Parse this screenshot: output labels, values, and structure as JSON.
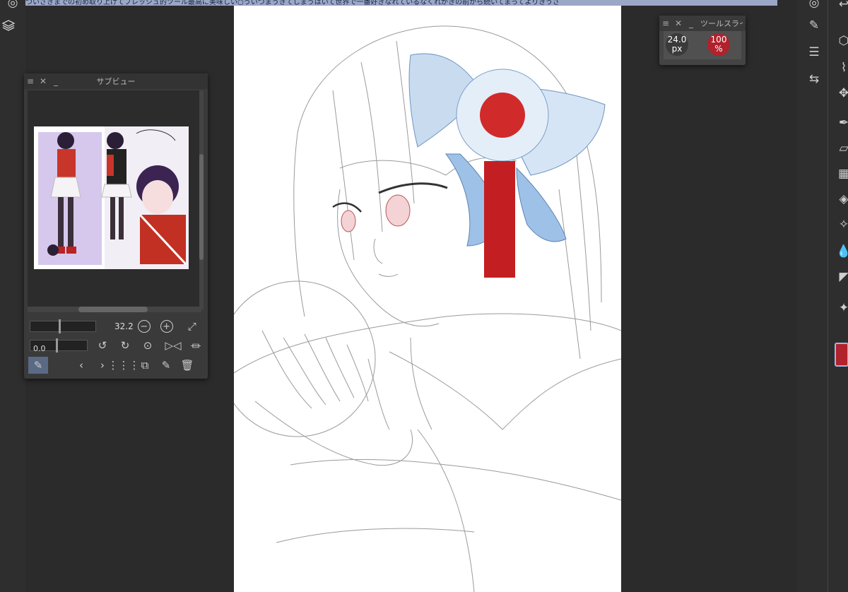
{
  "banner": {
    "text": "ついさきまでの初め取り上げてブレッシュ的ツール最高に美味しい○ういつまうきてしまうはいて世界で一番好きなれているなくれがきの前から続いてまってよりきうさ"
  },
  "subview": {
    "title": "サブビュー",
    "zoom_value": "32.2",
    "rotate_value": "0.0"
  },
  "tool_slider": {
    "title": "ツールスライ",
    "size_value": "24.0",
    "size_unit": "px",
    "opacity_value": "100",
    "opacity_unit": "%"
  },
  "colors": {
    "main_color": "#b0222c",
    "highlight": "#9fb7e8"
  },
  "icons": {
    "left": [
      "layers-icon"
    ],
    "right": [
      "brush-settings-icon",
      "adjust-sliders-icon",
      "swap-arrows-icon",
      "undo-icon",
      "cube-icon",
      "lasso-icon",
      "move-icon",
      "pen-icon",
      "eraser-icon",
      "gradient-icon",
      "fill-icon",
      "sparkle-icon",
      "blend-icon",
      "triangle-icon",
      "star-icon"
    ]
  }
}
